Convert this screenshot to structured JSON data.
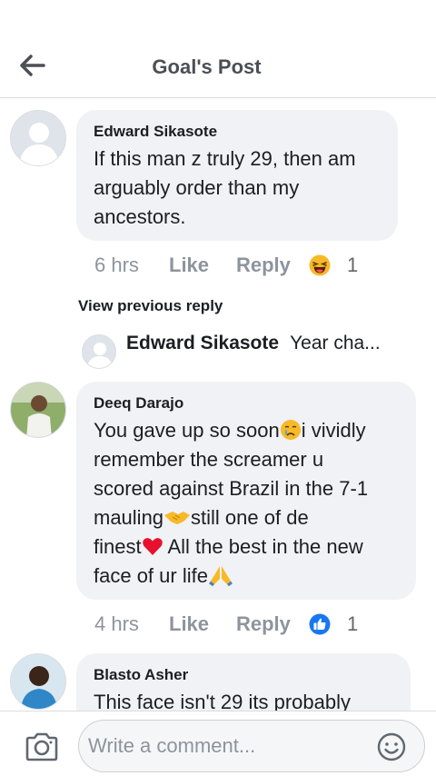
{
  "header": {
    "title": "Goal's Post",
    "back_icon": "arrow-left-icon"
  },
  "comments": [
    {
      "name": "Edward Sikasote",
      "text_lines": [
        "If this man z truly 29, then am",
        "arguably order than my",
        "ancestors."
      ],
      "time": "6 hrs",
      "like_label": "Like",
      "reply_label": "Reply",
      "reaction_icon": "haha-icon",
      "reaction_count": "1"
    },
    {
      "name": "Deeq Darajo",
      "text_parts": {
        "l1a": "You gave up so soon",
        "l1b": "i vividly",
        "l2": "remember the screamer u",
        "l3": "scored against Brazil in the 7-1",
        "l4a": "mauling",
        "l4b": "still one of de",
        "l5a": "finest",
        "l5b": " All the best in the new",
        "l6a": "face of ur life"
      },
      "emoji_icons": [
        "crying-face-icon",
        "handshake-icon",
        "red-heart-icon",
        "folded-hands-icon"
      ],
      "time": "4 hrs",
      "like_label": "Like",
      "reply_label": "Reply",
      "reaction_icon": "like-icon",
      "reaction_count": "1"
    },
    {
      "name": "Blasto Asher",
      "text": "This face isn't 29 its probably"
    }
  ],
  "view_previous": "View previous reply",
  "reply_preview": {
    "name": "Edward Sikasote",
    "text": "Year cha..."
  },
  "composer": {
    "placeholder": "Write a comment...",
    "camera_icon": "camera-icon",
    "emoji_icon": "smiley-icon"
  },
  "colors": {
    "bubble": "#f0f2f5",
    "meta_text": "#8d949e",
    "like_blue": "#1877f2",
    "haha_yellow": "#f7b928"
  }
}
